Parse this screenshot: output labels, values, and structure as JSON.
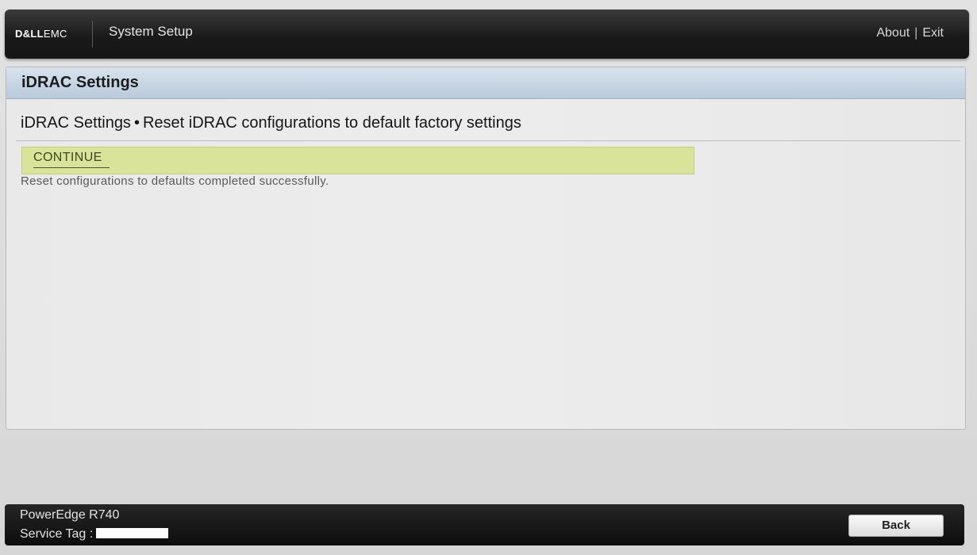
{
  "header": {
    "logo_dell": "D&LL",
    "logo_emc": "EMC",
    "app_title": "System Setup",
    "about_label": "About",
    "separator": "|",
    "exit_label": "Exit"
  },
  "panel": {
    "title": "iDRAC Settings",
    "breadcrumb_parent": "iDRAC Settings",
    "breadcrumb_bullet": "•",
    "breadcrumb_current": "Reset iDRAC configurations to default factory settings",
    "continue_label": "CONTINUE",
    "status_message": "Reset configurations to defaults completed successfully."
  },
  "footer": {
    "model": "PowerEdge R740",
    "service_tag_label": "Service Tag :",
    "back_label": "Back"
  },
  "colors": {
    "header_bg": "#1a1a1a",
    "panel_header_bg": "#c7d5e3",
    "continue_bg": "#d9e39a",
    "footer_bg": "#0d0d0d"
  }
}
